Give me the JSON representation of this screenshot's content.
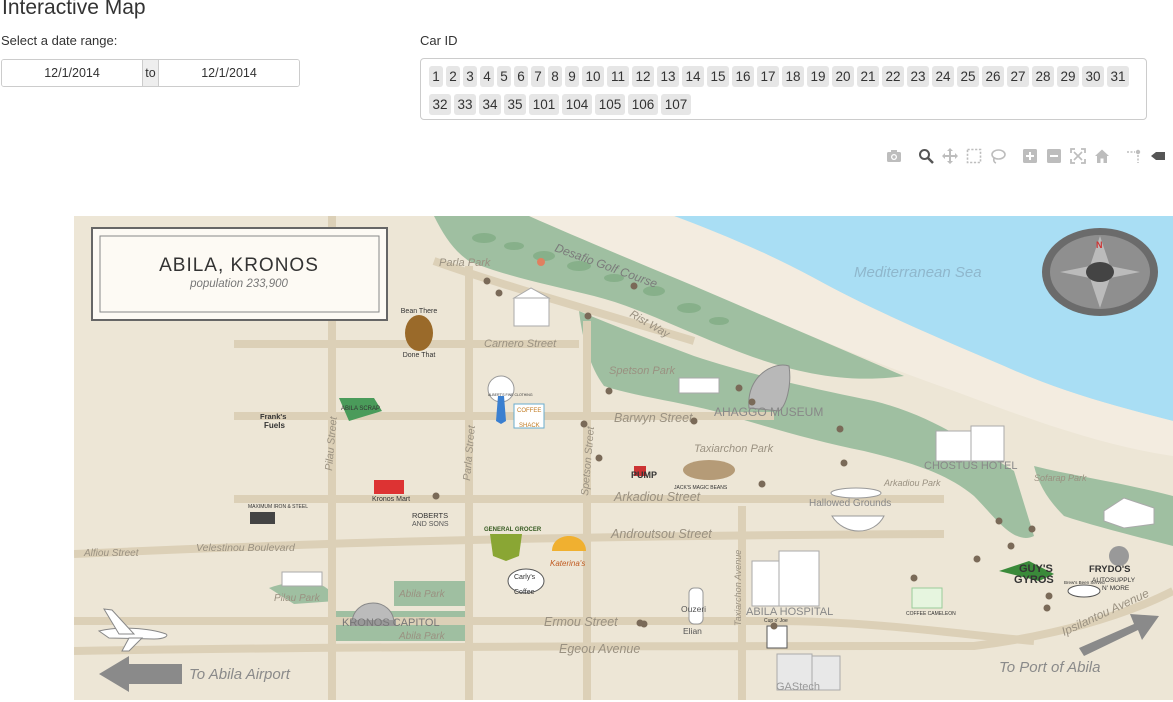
{
  "page": {
    "title": "Interactive Map"
  },
  "date_range": {
    "label": "Select a date range:",
    "start": "12/1/2014",
    "separator": "to",
    "end": "12/1/2014"
  },
  "car_filter": {
    "label": "Car ID",
    "options": [
      "1",
      "2",
      "3",
      "4",
      "5",
      "6",
      "7",
      "8",
      "9",
      "10",
      "11",
      "12",
      "13",
      "14",
      "15",
      "16",
      "17",
      "18",
      "19",
      "20",
      "21",
      "22",
      "23",
      "24",
      "25",
      "26",
      "27",
      "28",
      "29",
      "30",
      "31",
      "32",
      "33",
      "34",
      "35",
      "101",
      "104",
      "105",
      "106",
      "107"
    ]
  },
  "modebar": [
    "camera-icon",
    "zoom-icon",
    "pan-icon",
    "box-select-icon",
    "lasso-icon",
    "zoom-in-icon",
    "zoom-out-icon",
    "autoscale-icon",
    "reset-axes-icon",
    "spike-lines-icon",
    "hover-compare-icon"
  ],
  "map": {
    "title": "ABILA, KRONOS",
    "population": "population 233,900",
    "sea": "Mediterranean Sea",
    "streets": {
      "parla_park_top": "Parla Park",
      "desafio": "Desafio Golf Course",
      "carnero": "Carnero Street",
      "rist": "Rist Way",
      "spetson_park": "Spetson Park",
      "barwyn": "Barwyn Street",
      "taxiarchon_park": "Taxiarchon Park",
      "arkadiou": "Arkadiou Street",
      "arkadiou_park": "Arkadiou Park",
      "androutsou": "Androutsou Street",
      "alfiou": "Alfiou Street",
      "velestinou": "Velestinou Boulevard",
      "pilau_street": "Pilau Street",
      "parla_street": "Parla Street",
      "spetson_street": "Spetson Street",
      "taxiarchon_ave": "Taxiarchon Avenue",
      "pilau_park": "Pilau Park",
      "abila_park_1": "Abila Park",
      "abila_park_2": "Abila Park",
      "ermou": "Ermou Street",
      "egeou": "Egeou Avenue",
      "ipsilantou": "Ipsilantou Avenue",
      "airport": "To Abila Airport",
      "port": "To Port of Abila",
      "sofarap_park": "Sofarap Park"
    },
    "places": {
      "ahaggo": "AHAGGO MUSEUM",
      "chostus": "CHOSTUS HOTEL",
      "hallowed": "Hallowed Grounds",
      "hospital": "ABILA HOSPITAL",
      "capitol": "KRONOS CAPITOL",
      "gastech": "GAStech",
      "bean_there_1": "Bean There",
      "bean_there_2": "Done That",
      "franks_1": "Frank's",
      "franks_2": "Fuels",
      "abila_scrap": "ABILA SCRAP",
      "kronos_mart": "Kronos Mart",
      "roberts_1": "ROBERTS",
      "roberts_2": "AND SONS",
      "maximum": "MAXIMUM IRON & STEEL",
      "general_grocer": "GENERAL GROCER",
      "katerina": "Katerina's",
      "carlys_1": "Carly's",
      "carlys_2": "Coffee",
      "coffee_shack_1": "COFFEE",
      "coffee_shack_2": "SHACK",
      "albert": "ALBERT'S FINE CLOTHING",
      "upump": "PUMP",
      "jacks": "JACK'S MAGIC BEANS",
      "ouzeri_1": "Ouzeri",
      "ouzeri_2": "Elian",
      "cup_1": "Cup o' Joe",
      "guys_1": "GUY'S",
      "guys_2": "GYROS",
      "frydos_1": "FRYDO'S",
      "frydos_2": "AUTOSUPPLY",
      "frydos_3": "N' MORE",
      "brews": "Brew's Been Served",
      "chostus_small": "COFFEE CAMELEON"
    }
  }
}
